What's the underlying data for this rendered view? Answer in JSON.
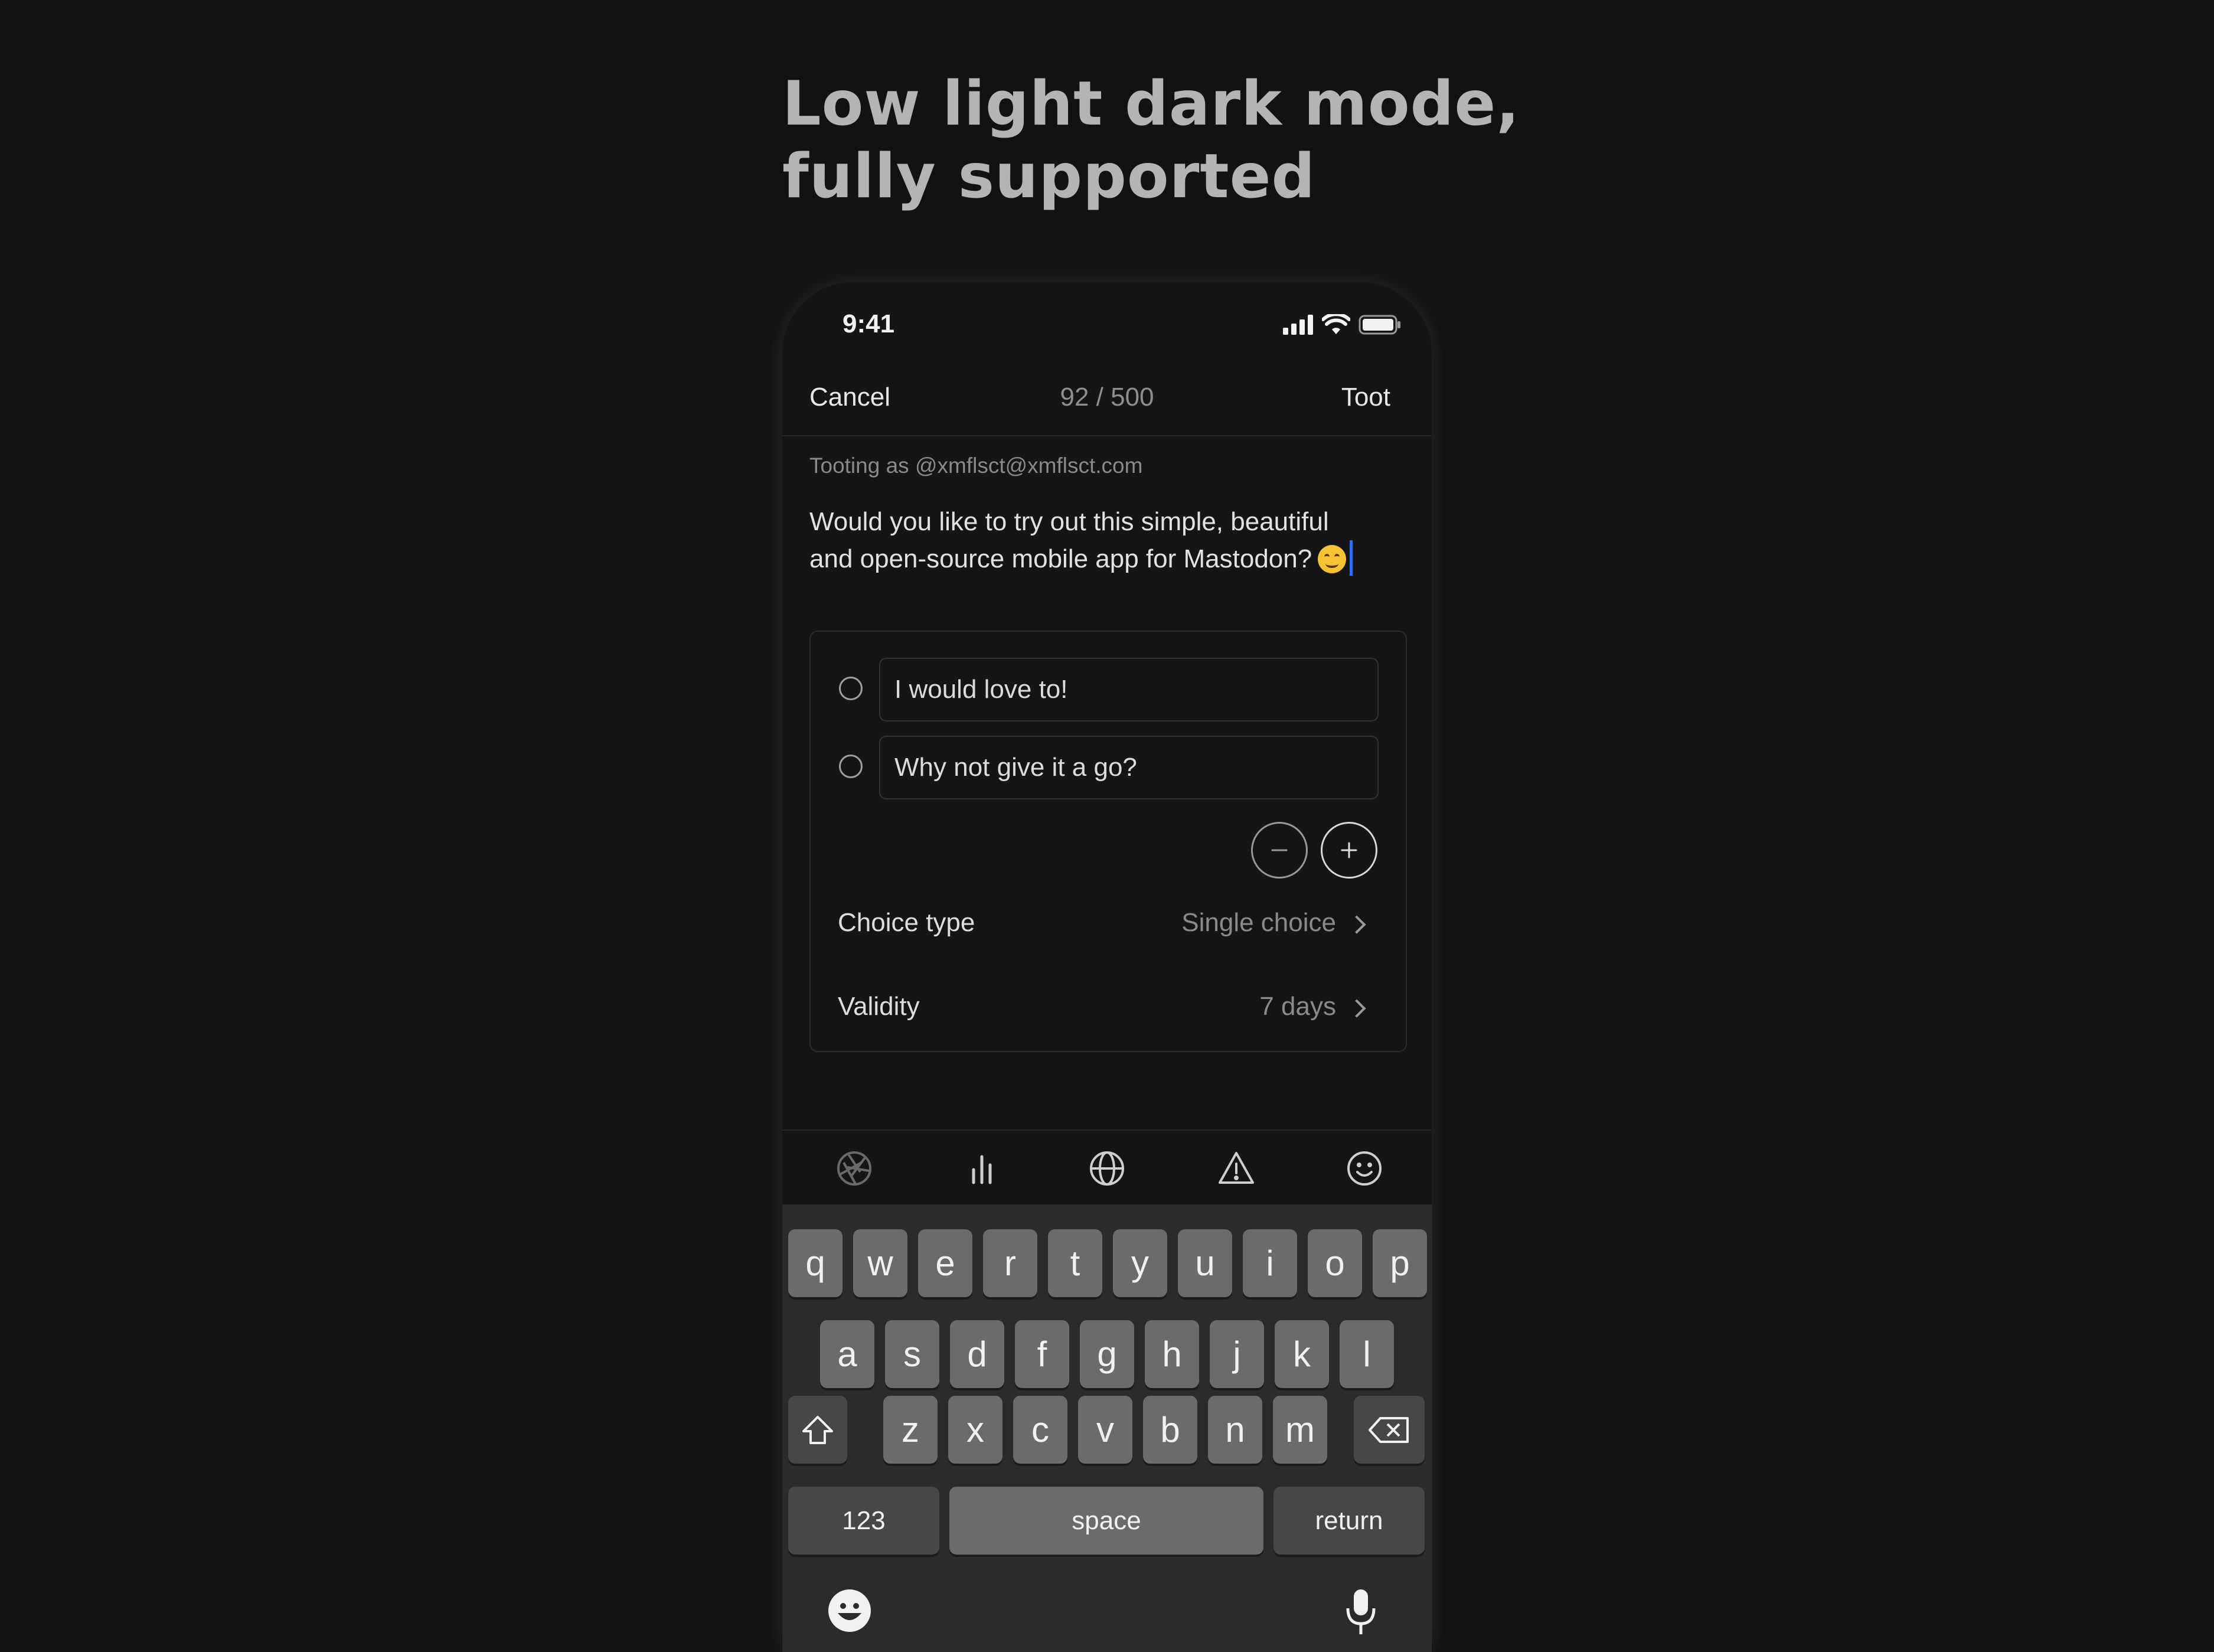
{
  "headline": {
    "line1": "Low light dark mode,",
    "line2": "fully supported"
  },
  "status_bar": {
    "time": "9:41"
  },
  "nav": {
    "cancel": "Cancel",
    "count": "92 / 500",
    "toot": "Toot"
  },
  "compose": {
    "account": "Tooting as @xmflsct@xmflsct.com",
    "line1": "Would you like to try out this simple, beautiful",
    "line2": "and open-source mobile app for Mastodon?"
  },
  "poll": {
    "options": [
      "I would love to!",
      "Why not give it a go?"
    ],
    "choice_type_label": "Choice type",
    "choice_type_value": "Single choice",
    "validity_label": "Validity",
    "validity_value": "7 days"
  },
  "toolbar": {
    "icons": [
      "camera-aperture-icon",
      "poll-icon",
      "globe-icon",
      "warning-icon",
      "emoji-icon"
    ]
  },
  "keyboard": {
    "row1": [
      "q",
      "w",
      "e",
      "r",
      "t",
      "y",
      "u",
      "i",
      "o",
      "p"
    ],
    "row2": [
      "a",
      "s",
      "d",
      "f",
      "g",
      "h",
      "j",
      "k",
      "l"
    ],
    "row3": [
      "z",
      "x",
      "c",
      "v",
      "b",
      "n",
      "m"
    ],
    "numbers": "123",
    "space": "space",
    "return": "return"
  },
  "colors": {
    "background": "#121212",
    "accent_cursor": "#2e6ff2",
    "key": "#6b6b6b"
  }
}
